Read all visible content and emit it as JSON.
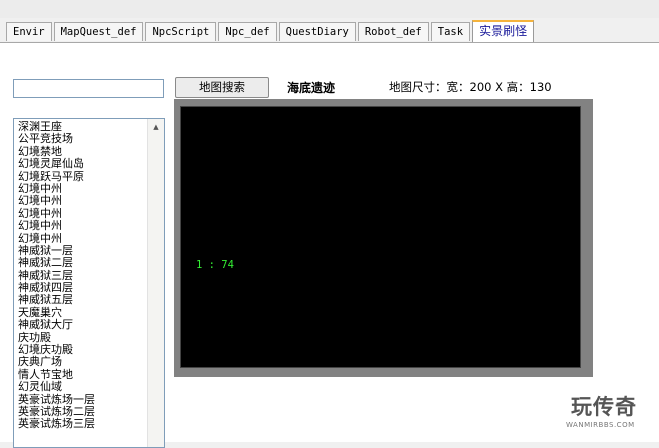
{
  "tabs": [
    {
      "label": "Envir",
      "active": false
    },
    {
      "label": "MapQuest_def",
      "active": false
    },
    {
      "label": "NpcScript",
      "active": false
    },
    {
      "label": "Npc_def",
      "active": false
    },
    {
      "label": "QuestDiary",
      "active": false
    },
    {
      "label": "Robot_def",
      "active": false
    },
    {
      "label": "Task",
      "active": false
    },
    {
      "label": "实景刷怪",
      "active": true
    }
  ],
  "search": {
    "value": "",
    "placeholder": ""
  },
  "map_list": {
    "items": [
      "深渊王座",
      "公平竞技场",
      "幻境禁地",
      "幻境灵犀仙岛",
      "幻境跃马平原",
      "幻境中州",
      "幻境中州",
      "幻境中州",
      "幻境中州",
      "幻境中州",
      "神威狱一层",
      "神威狱二层",
      "神威狱三层",
      "神威狱四层",
      "神威狱五层",
      "天魔巢穴",
      "神威狱大厅",
      "庆功殿",
      "幻境庆功殿",
      "庆典广场",
      "情人节宝地",
      "幻灵仙域",
      "英豪试炼场一层",
      "英豪试炼场二层",
      "英豪试炼场三层"
    ]
  },
  "toolbar": {
    "map_search_label": "地图搜索",
    "map_name": "海底遗迹",
    "map_size_text": "地图尺寸：宽：200 X 高：130"
  },
  "canvas": {
    "coordinate_readout": "1 : 74",
    "background": "#000000",
    "text_color": "#33ee33"
  },
  "watermark": {
    "title": "玩传奇",
    "subtitle": "WANMIRBBS.COM"
  }
}
